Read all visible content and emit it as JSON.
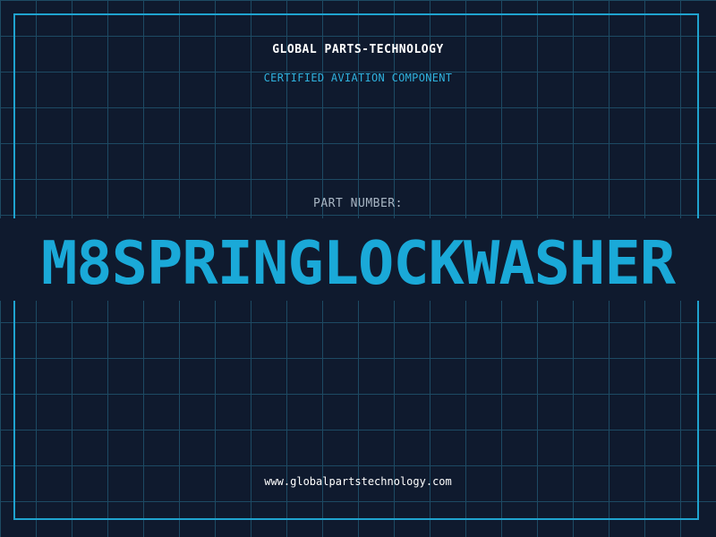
{
  "header": {
    "company": "GLOBAL PARTS-TECHNOLOGY",
    "tagline": "CERTIFIED AVIATION COMPONENT"
  },
  "part": {
    "label": "PART NUMBER:",
    "number": "M8SPRINGLOCKWASHER"
  },
  "footer": {
    "website": "www.globalpartstechnology.com"
  },
  "colors": {
    "background": "#0f1a2e",
    "grid": "#1d4a63",
    "accent": "#1aa9d8",
    "frame": "#1fa3cf"
  }
}
